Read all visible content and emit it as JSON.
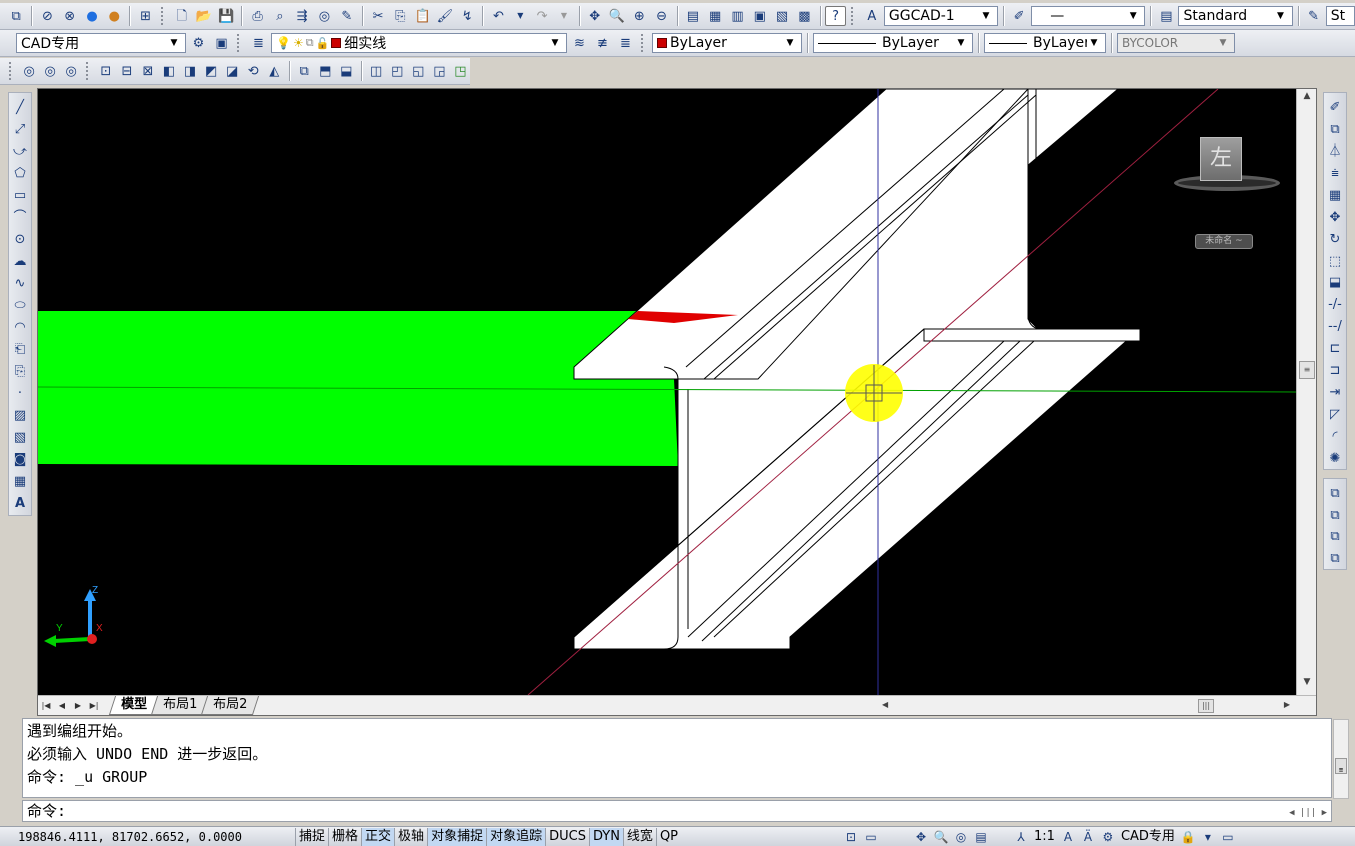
{
  "toolbar1": {
    "layer_state": "GGCAD-1",
    "linetype_simple": "—",
    "text_style": "Standard",
    "cut_text": "St"
  },
  "toolbar2": {
    "workspace": "CAD专用",
    "layer": "细实线",
    "color": "ByLayer",
    "linetype": "ByLayer",
    "lineweight": "ByLayer",
    "plotstyle": "BYCOLOR"
  },
  "canvas": {
    "background": "#000000",
    "viewcube_face": "左",
    "wcs_label": "未命名 ~",
    "ucs_z": "Z",
    "ucs_y": "Y",
    "ucs_x": "X"
  },
  "layout_tabs": [
    "模型",
    "布局1",
    "布局2"
  ],
  "command": {
    "history": [
      "遇到编组开始。",
      "必须输入 UNDO END 进一步返回。",
      "命令: _u GROUP"
    ],
    "prompt": "命令:"
  },
  "status": {
    "coordinates": "198846.4111, 81702.6652, 0.0000",
    "toggles": [
      {
        "label": "捕捉",
        "on": false
      },
      {
        "label": "栅格",
        "on": false
      },
      {
        "label": "正交",
        "on": true
      },
      {
        "label": "极轴",
        "on": false
      },
      {
        "label": "对象捕捉",
        "on": true
      },
      {
        "label": "对象追踪",
        "on": true
      },
      {
        "label": "DUCS",
        "on": false
      },
      {
        "label": "DYN",
        "on": true
      },
      {
        "label": "线宽",
        "on": false
      },
      {
        "label": "QP",
        "on": false
      }
    ],
    "annotation_scale": "1:1",
    "workspace": "CAD专用"
  },
  "colors": {
    "green_fill": "#00ff00",
    "beam_fill": "#ffffff",
    "highlight": "#ffff00",
    "red_marker": "#e00000"
  }
}
